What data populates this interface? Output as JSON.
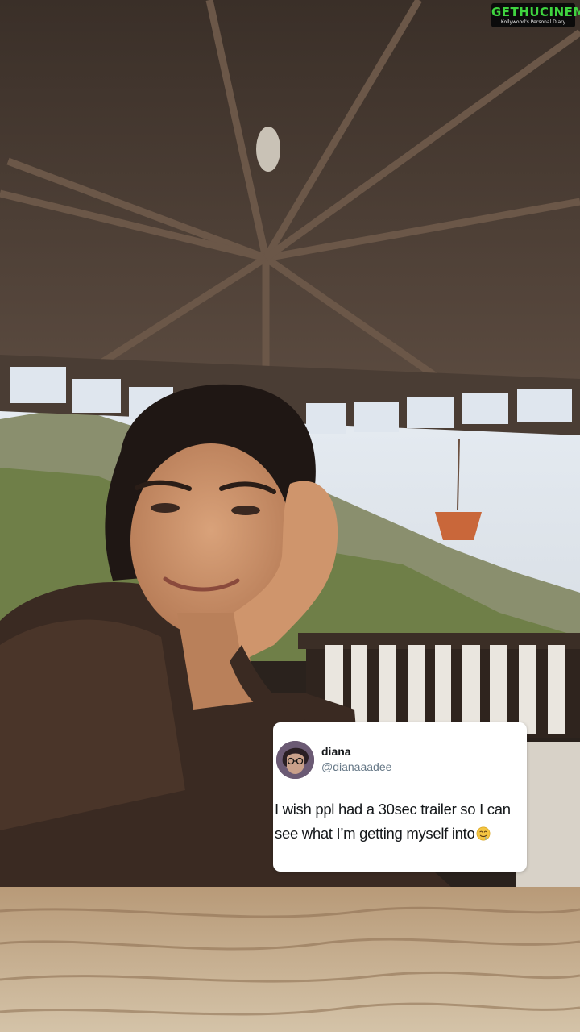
{
  "watermark": {
    "brand": "GETHUCINEMA",
    "tagline": "Kollywood's Personal Diary"
  },
  "tweet": {
    "name": "diana",
    "handle": "@dianaaadee",
    "text": "I wish ppl had a 30sec trailer so I can see what I’m getting myself into",
    "trailing_emoji": "drooling-face-emoji"
  },
  "colors": {
    "card_bg": "#ffffff",
    "name": "#14171a",
    "handle": "#657786",
    "watermark_green": "#3fd43f"
  }
}
